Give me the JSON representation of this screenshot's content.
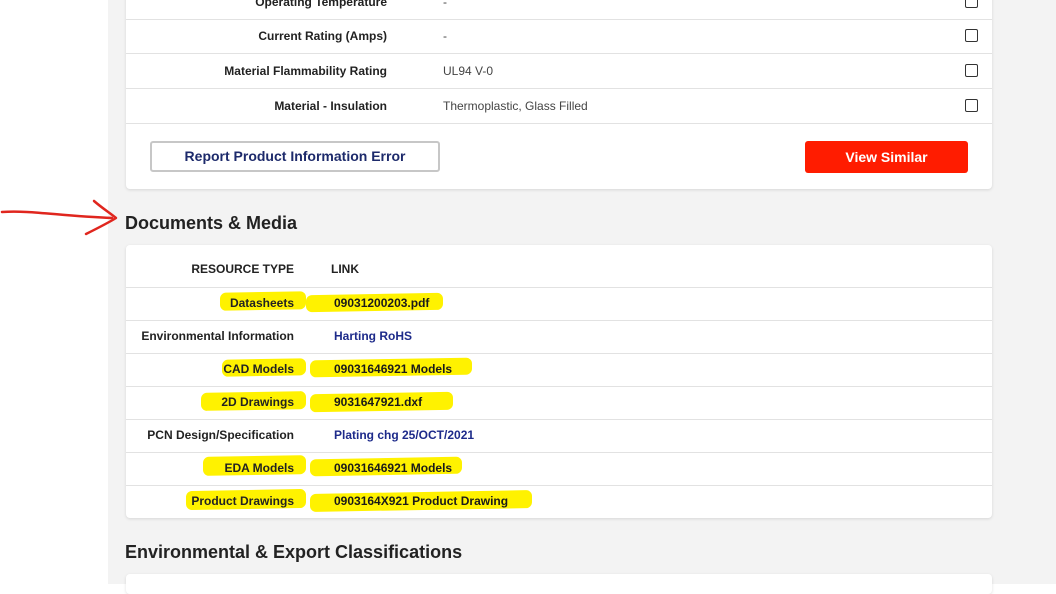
{
  "attributes": {
    "rows": [
      {
        "name": "Operating Temperature",
        "value": "-"
      },
      {
        "name": "Current Rating (Amps)",
        "value": "-"
      },
      {
        "name": "Material Flammability Rating",
        "value": "UL94 V-0"
      },
      {
        "name": "Material - Insulation",
        "value": "Thermoplastic, Glass Filled"
      }
    ],
    "report_label": "Report Product Information Error",
    "similar_label": "View Similar"
  },
  "documents": {
    "title": "Documents & Media",
    "header": {
      "type": "RESOURCE TYPE",
      "link": "LINK"
    },
    "rows": [
      {
        "type": "Datasheets",
        "link": "09031200203.pdf",
        "highlighted": true
      },
      {
        "type": "Environmental Information",
        "link": "Harting RoHS",
        "highlighted": false
      },
      {
        "type": "CAD Models",
        "link": "09031646921 Models",
        "highlighted": true
      },
      {
        "type": "2D Drawings",
        "link": "9031647921.dxf",
        "highlighted": true
      },
      {
        "type": "PCN Design/Specification",
        "link": "Plating chg 25/OCT/2021",
        "highlighted": false
      },
      {
        "type": "EDA Models",
        "link": "09031646921 Models",
        "highlighted": true
      },
      {
        "type": "Product Drawings",
        "link": "0903164X921 Product Drawing",
        "highlighted": true
      }
    ]
  },
  "environmental": {
    "title": "Environmental & Export Classifications"
  },
  "colors": {
    "accent": "#ff1c00",
    "link": "#1d2a8a",
    "highlighter": "#fff200",
    "annotation_arrow": "#e0261e"
  }
}
